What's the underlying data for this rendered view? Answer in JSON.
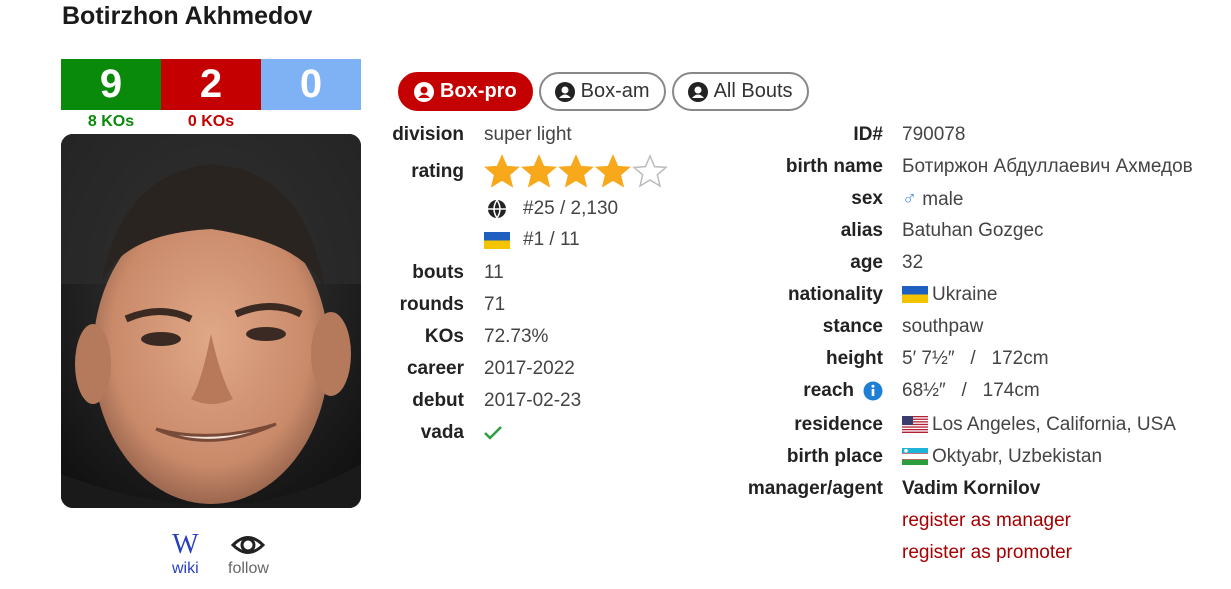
{
  "boxer": {
    "name": "Botirzhon Akhmedov",
    "record": {
      "wins": "9",
      "losses": "2",
      "draws": "0",
      "wins_ko": "8 KOs",
      "losses_ko": "0 KOs"
    }
  },
  "tabs": [
    {
      "label": "Box-pro",
      "active": true
    },
    {
      "label": "Box-am",
      "active": false
    },
    {
      "label": "All Bouts",
      "active": false
    }
  ],
  "stats": {
    "division": {
      "label": "division",
      "value": "super light"
    },
    "rating": {
      "label": "rating",
      "stars": 4,
      "max_stars": 5,
      "world_rank": "#25 / 2,130",
      "country_rank": "#1 / 11"
    },
    "bouts": {
      "label": "bouts",
      "value": "11"
    },
    "rounds": {
      "label": "rounds",
      "value": "71"
    },
    "kos": {
      "label": "KOs",
      "value": "72.73%"
    },
    "career": {
      "label": "career",
      "value": "2017-2022"
    },
    "debut": {
      "label": "debut",
      "value": "2017-02-23"
    },
    "vada": {
      "label": "vada",
      "icon": "check-icon"
    }
  },
  "bio": {
    "id": {
      "label": "ID#",
      "value": "790078"
    },
    "birth_name": {
      "label": "birth name",
      "value": "Ботиржон Абдуллаевич Ахмедов"
    },
    "sex": {
      "label": "sex",
      "value": "male"
    },
    "alias": {
      "label": "alias",
      "value": "Batuhan Gozgec"
    },
    "age": {
      "label": "age",
      "value": "32"
    },
    "nationality": {
      "label": "nationality",
      "value": "Ukraine"
    },
    "stance": {
      "label": "stance",
      "value": "southpaw"
    },
    "height": {
      "label": "height",
      "value": "5′ 7½″   /   172cm"
    },
    "reach": {
      "label": "reach",
      "value": "68½″   /   174cm"
    },
    "residence": {
      "label": "residence",
      "value": "Los Angeles, California, USA"
    },
    "birth_place": {
      "label": "birth place",
      "value": "Oktyabr, Uzbekistan"
    },
    "manager": {
      "label": "manager/agent",
      "value": "Vadim Kornilov"
    },
    "register_manager": "register as manager",
    "register_promoter": "register as promoter"
  },
  "actions": {
    "wiki": "wiki",
    "follow": "follow"
  },
  "colors": {
    "win": "#0a8a0a",
    "loss": "#c40000",
    "draw": "#7fb2f5",
    "star": "#f7a81b",
    "link_red": "#a50000"
  }
}
